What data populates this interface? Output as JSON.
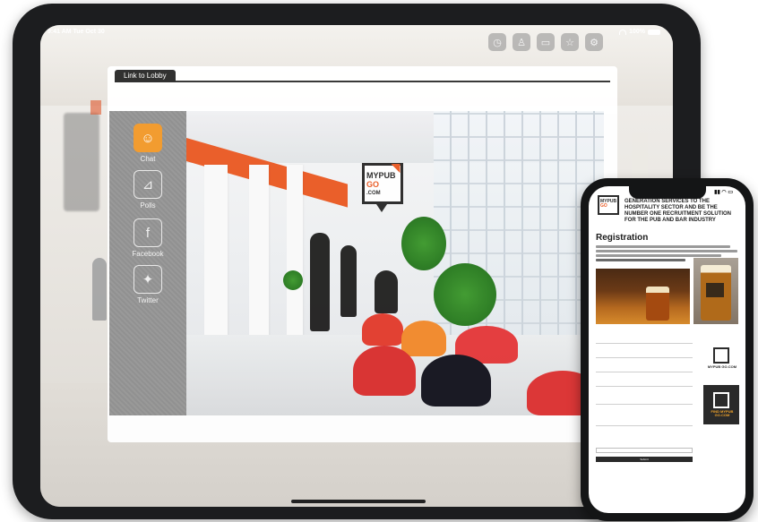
{
  "ipad": {
    "status": {
      "time": "9:41 AM  Tue Oct 30",
      "battery": "100%"
    },
    "top_icons": [
      "clock-icon",
      "user-icon",
      "video-icon",
      "star-icon",
      "gear-icon"
    ],
    "tab_label": "Link to Lobby",
    "sidebar": [
      {
        "label": "Chat",
        "icon": "chat-icon",
        "active": true
      },
      {
        "label": "Polls",
        "icon": "polls-icon",
        "active": false
      },
      {
        "label": "Facebook",
        "icon": "facebook-icon",
        "active": false
      },
      {
        "label": "Twitter",
        "icon": "twitter-icon",
        "active": false
      }
    ],
    "logo": {
      "line1": "MYPUB",
      "line2": "GO",
      "line3": ".COM"
    },
    "background_sign": "MYPUB GO .COM"
  },
  "iphone": {
    "headline": "Generation services to the hospitality sector and be the number one recruitment solution for the pub and bar industry",
    "title": "Registration",
    "logo": {
      "line1": "MYPUB",
      "line2": "GO"
    },
    "tile_dark_text": "FIND MYPUB GO.COM",
    "tile_white_text": "MYPUB GO.COM",
    "submit_label": "Submit"
  },
  "colors": {
    "accent": "#ea5b25",
    "active_button": "#f39a2b",
    "device_frame": "#1c1d1f"
  }
}
